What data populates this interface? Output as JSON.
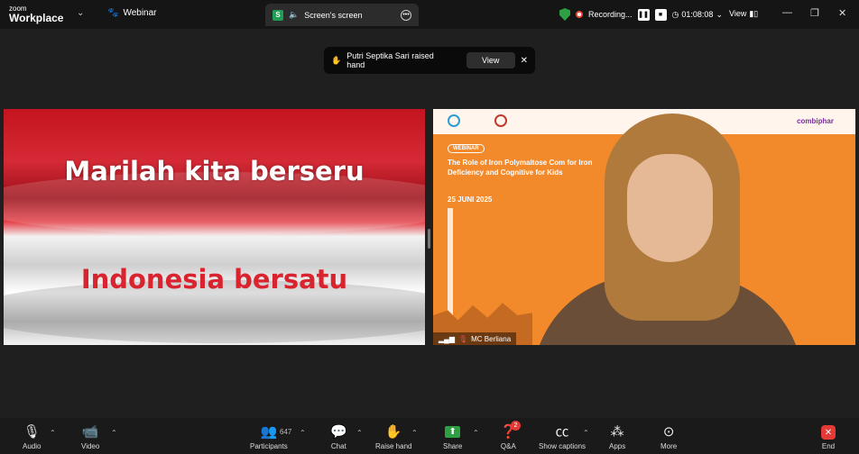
{
  "app": {
    "logo_top": "zoom",
    "logo_bottom": "Workplace",
    "meeting_name": "Webinar"
  },
  "share_tab": {
    "badge": "S",
    "label": "Screen's screen"
  },
  "recording": {
    "label": "Recording...",
    "timer": "01:08:08",
    "view_label": "View"
  },
  "notification": {
    "text": "Putri Septika Sari raised hand",
    "view_button": "View"
  },
  "slide": {
    "line1": "Marilah kita berseru",
    "line2": "Indonesia bersatu"
  },
  "speaker": {
    "name": "MC Berliana",
    "brand": "combiphar",
    "webinar_pill": "WEBINAR",
    "title": "The Role of Iron Polymaltose Com for Iron Deficiency and Cognitive for Kids",
    "date": "25 JUNI 2025"
  },
  "toolbar": {
    "audio": "Audio",
    "video": "Video",
    "participants": "Participants",
    "participants_count": "647",
    "chat": "Chat",
    "raise_hand": "Raise hand",
    "share": "Share",
    "qa": "Q&A",
    "qa_badge": "2",
    "captions": "Show captions",
    "apps": "Apps",
    "more": "More",
    "end": "End"
  },
  "colors": {
    "share_green": "#2ea043",
    "end_red": "#e53935",
    "slide_red": "#d9232e",
    "speaker_bg": "#f28a2c"
  }
}
